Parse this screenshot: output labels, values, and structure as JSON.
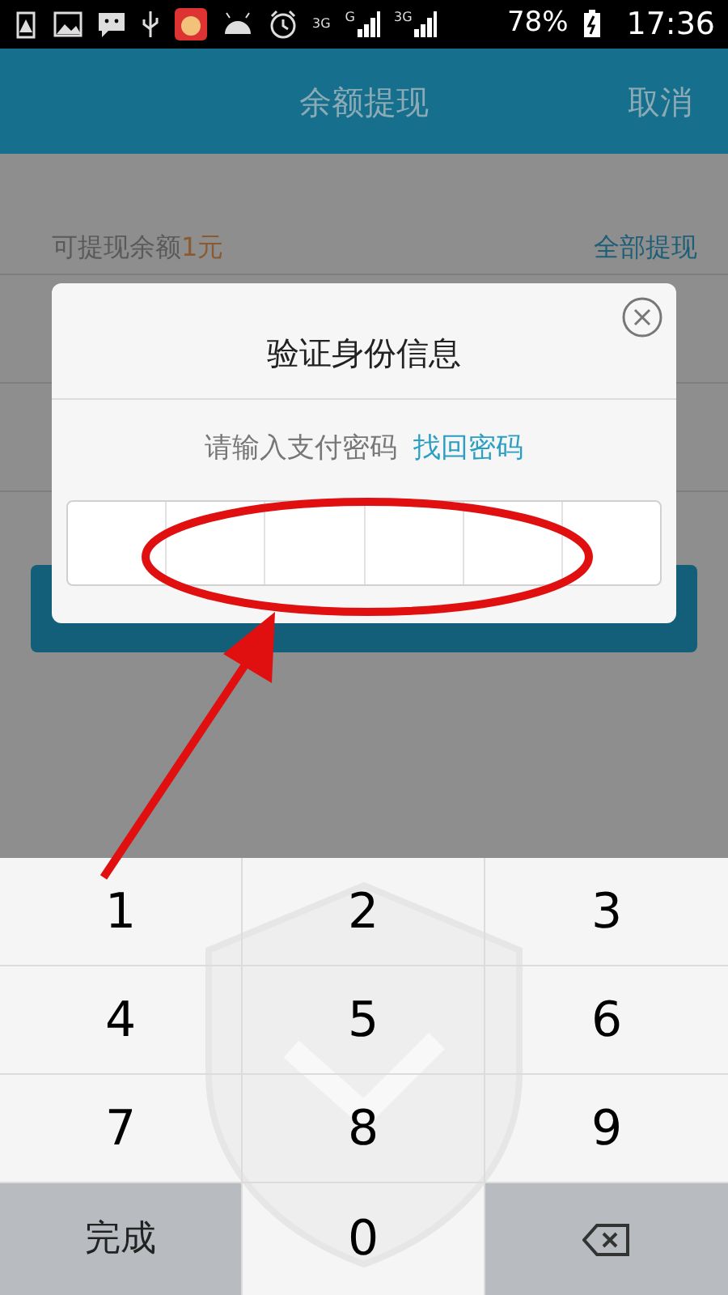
{
  "status_bar": {
    "network": [
      "3G",
      "G",
      "3G"
    ],
    "battery": "78%",
    "time": "17:36"
  },
  "header": {
    "title": "余额提现",
    "action": "取消"
  },
  "background": {
    "balance_label": "可提现余额",
    "balance_amount": "1元",
    "withdraw_all": "全部提现"
  },
  "dialog": {
    "title": "验证身份信息",
    "prompt": "请输入支付密码",
    "recover_link": "找回密码",
    "pin_boxes": [
      {
        "filled": false
      },
      {
        "filled": false
      },
      {
        "filled": false
      },
      {
        "filled": false
      },
      {
        "filled": false
      },
      {
        "filled": false
      }
    ]
  },
  "keypad": {
    "keys": [
      {
        "kind": "digit",
        "label": "1"
      },
      {
        "kind": "digit",
        "label": "2"
      },
      {
        "kind": "digit",
        "label": "3"
      },
      {
        "kind": "digit",
        "label": "4"
      },
      {
        "kind": "digit",
        "label": "5"
      },
      {
        "kind": "digit",
        "label": "6"
      },
      {
        "kind": "digit",
        "label": "7"
      },
      {
        "kind": "digit",
        "label": "8"
      },
      {
        "kind": "digit",
        "label": "9"
      },
      {
        "kind": "action",
        "label": "完成"
      },
      {
        "kind": "digit",
        "label": "0"
      },
      {
        "kind": "delete"
      }
    ]
  }
}
